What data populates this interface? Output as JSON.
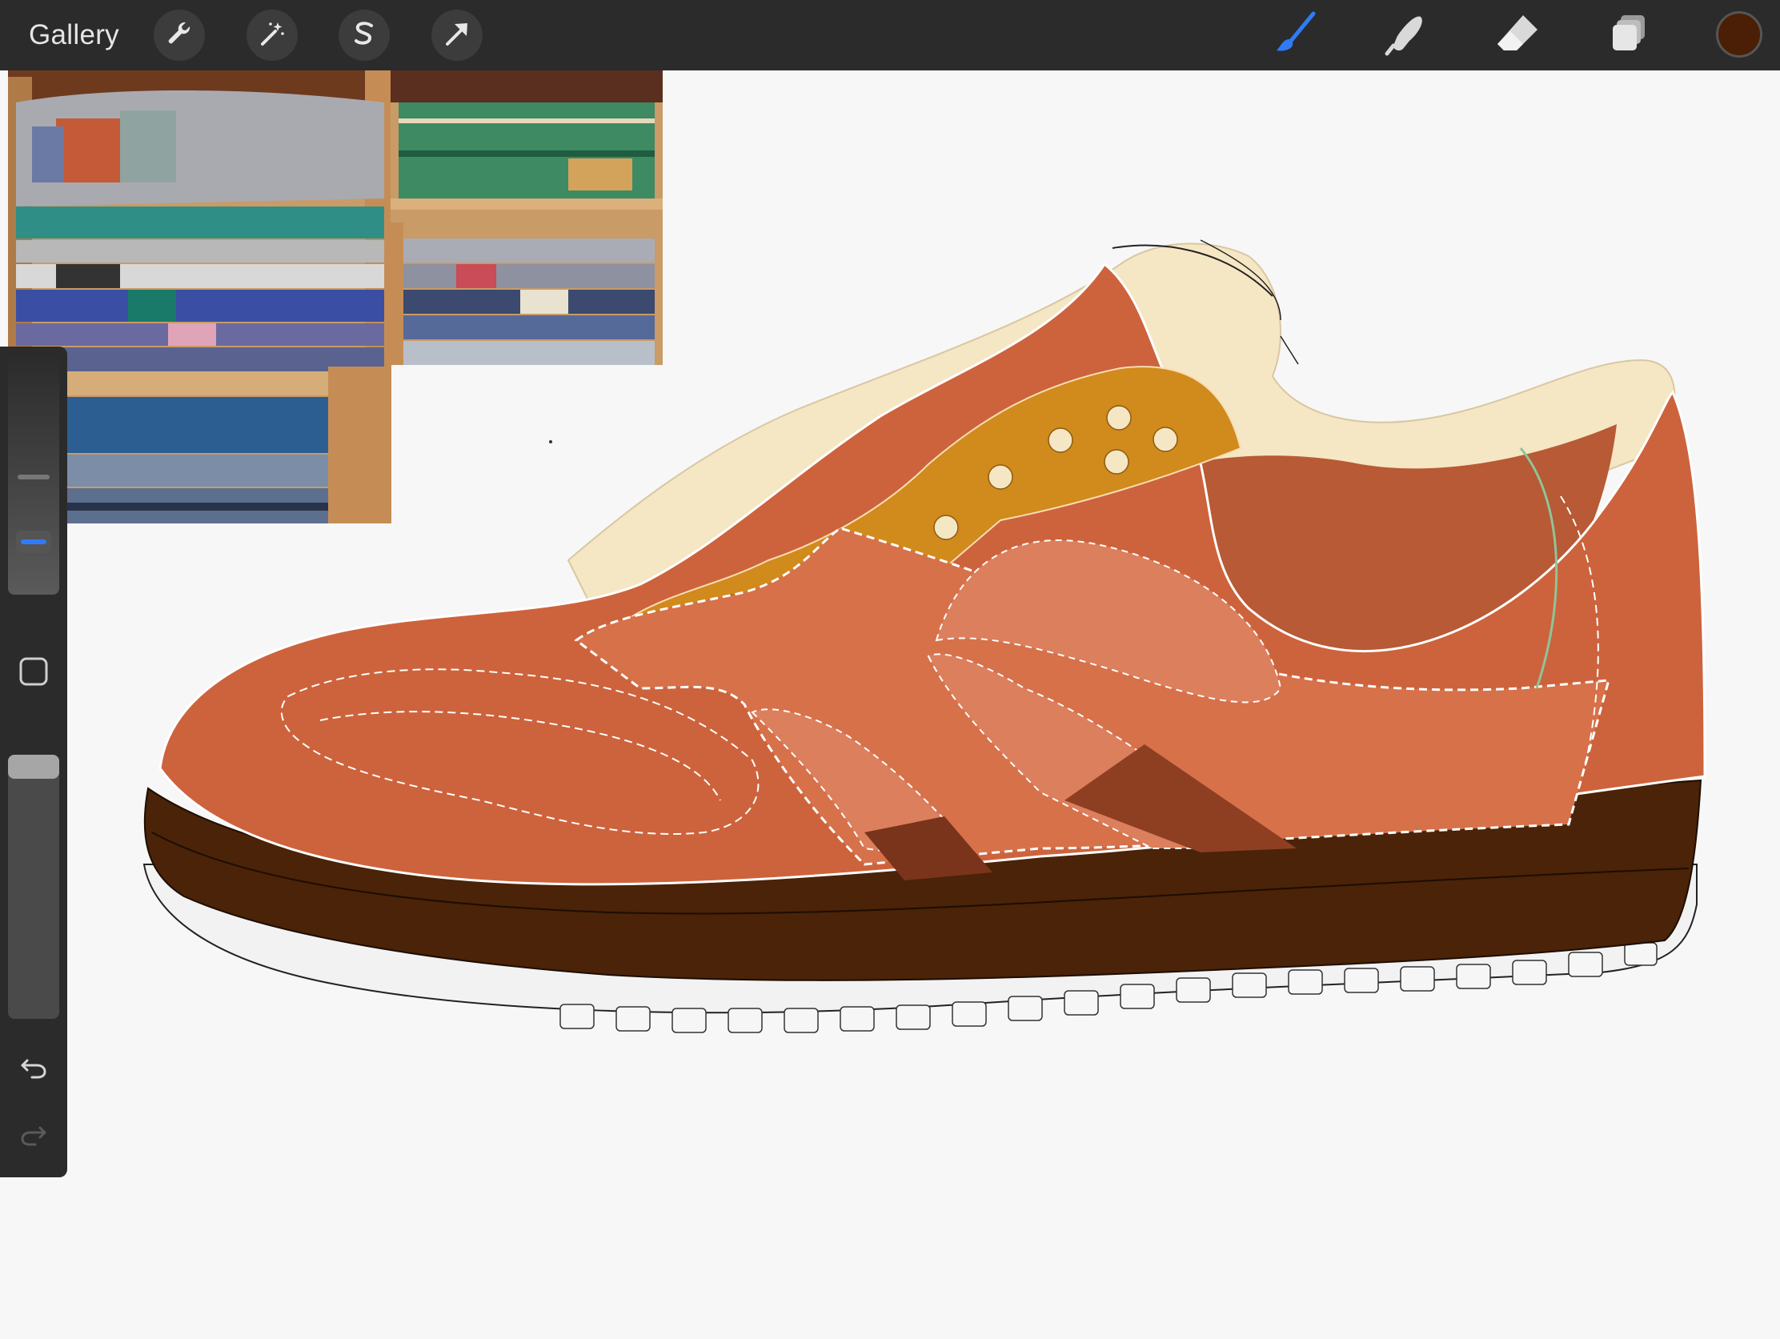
{
  "app": {
    "gallery_label": "Gallery"
  },
  "toolbar": {
    "left_tools": [
      {
        "name": "actions",
        "icon": "wrench-icon"
      },
      {
        "name": "adjustments",
        "icon": "magic-wand-icon"
      },
      {
        "name": "selection",
        "icon": "selection-s-icon"
      },
      {
        "name": "transform",
        "icon": "arrow-cursor-icon"
      }
    ],
    "right_tools": [
      {
        "name": "brush",
        "icon": "brush-icon",
        "active": true
      },
      {
        "name": "smudge",
        "icon": "smudge-finger-icon",
        "active": false
      },
      {
        "name": "eraser",
        "icon": "eraser-icon",
        "active": false
      },
      {
        "name": "layers",
        "icon": "layers-icon",
        "active": false
      }
    ],
    "current_color": "#4a1f05",
    "accent_color": "#2f7bf5"
  },
  "sidebar": {
    "brush_size_level": 0.72,
    "opacity_level": 0.0,
    "modify_button_icon": "square-icon",
    "undo_icon": "undo-icon",
    "redo_icon": "redo-icon"
  },
  "canvas": {
    "reference_images": [
      {
        "name": "reference-blankets-left",
        "icon": "photo-icon"
      },
      {
        "name": "reference-blankets-right",
        "icon": "photo-icon"
      }
    ],
    "palette": {
      "upper": "#cd633c",
      "upper_light": "#d6714a",
      "tongue": "#d18a1c",
      "lining": "#f5e6c4",
      "inner": "#b75a35",
      "panel_light": "#dc7f5d",
      "panel_dark": "#8e3f22",
      "sole": "#4a2308",
      "outsole": "#f2f2f2"
    }
  }
}
